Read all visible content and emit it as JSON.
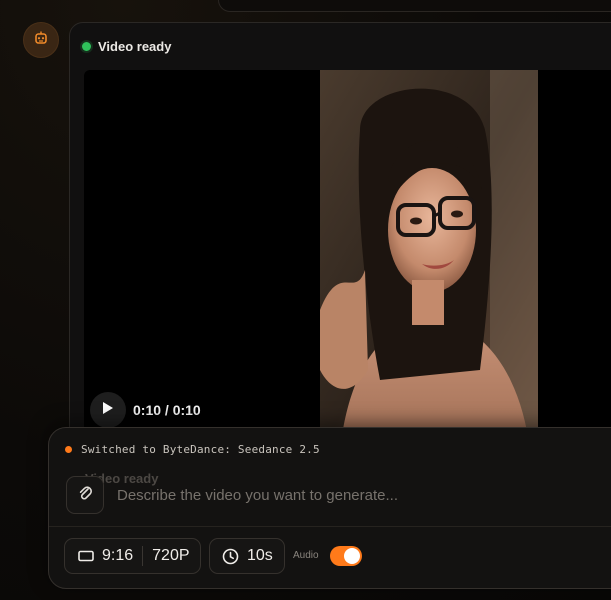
{
  "message": {
    "status_text": "Video ready",
    "status_color": "#2fc25b"
  },
  "player": {
    "timecode": "0:10 / 0:10",
    "progress": 1.0,
    "play_icon": "play-icon"
  },
  "composer": {
    "model_notice": "Switched to ByteDance: Seedance 2.5",
    "notice_color": "#ff7a1a",
    "ghost_label": "Video ready",
    "prompt_placeholder": "Describe the video you want to generate...",
    "prompt_value": "",
    "attach_icon": "paperclip-icon",
    "aspect_ratio": "9:16",
    "resolution": "720P",
    "duration": "10s",
    "audio_label": "Audio",
    "audio_enabled": true,
    "accent_color": "#ff7a1a"
  },
  "assistant": {
    "avatar_icon": "robot-icon",
    "avatar_color": "#3a2614"
  }
}
